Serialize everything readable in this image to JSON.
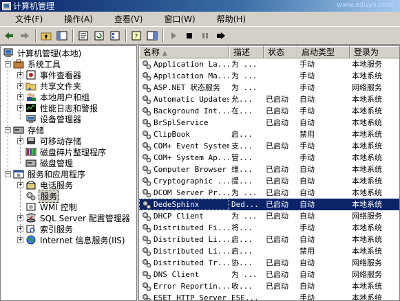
{
  "window": {
    "title": "计算机管理",
    "watermark": "www.eduyo.com"
  },
  "menu": [
    {
      "label": "文件(F)"
    },
    {
      "label": "操作(A)"
    },
    {
      "label": "查看(V)"
    },
    {
      "label": "窗口(W)"
    },
    {
      "label": "帮助(H)"
    }
  ],
  "toolbar": {
    "buttons": [
      "back-icon",
      "forward-icon",
      "up-folder-icon",
      "show-tree-icon",
      "properties-icon",
      "refresh-icon",
      "export-list-icon",
      "help-icon",
      "console-tree-icon",
      "play-icon",
      "stop-icon",
      "pause-icon",
      "restart-icon"
    ]
  },
  "tree": {
    "root": "计算机管理(本地)",
    "system_tools": "系统工具",
    "event_viewer": "事件查看器",
    "shared_folders": "共享文件夹",
    "local_users": "本地用户和组",
    "perf_logs": "性能日志和警报",
    "device_manager": "设备管理器",
    "storage": "存储",
    "removable": "可移动存储",
    "defrag": "磁盘碎片整理程序",
    "disk_mgmt": "磁盘管理",
    "services_apps": "服务和应用程序",
    "telephony": "电话服务",
    "services": "服务",
    "wmi": "WMI 控制",
    "sql": "SQL Server 配置管理器",
    "indexing": "索引服务",
    "iis": "Internet 信息服务(IIS)"
  },
  "columns": {
    "name": "名称",
    "desc": "描述",
    "status": "状态",
    "startup": "启动类型",
    "logon": "登录为"
  },
  "services": [
    {
      "name": "Application La...",
      "desc": "为 ...",
      "status": "",
      "startup": "手动",
      "logon": "本地服务"
    },
    {
      "name": "Application Ma...",
      "desc": "为 ...",
      "status": "",
      "startup": "手动",
      "logon": "本地系统"
    },
    {
      "name": "ASP.NET 状态服务",
      "desc": "为 ...",
      "status": "",
      "startup": "手动",
      "logon": "网络服务"
    },
    {
      "name": "Automatic Updates",
      "desc": "允...",
      "status": "已启动",
      "startup": "自动",
      "logon": "本地系统"
    },
    {
      "name": "Background Int...",
      "desc": "在...",
      "status": "已启动",
      "startup": "手动",
      "logon": "本地系统"
    },
    {
      "name": "BrSplService",
      "desc": "",
      "status": "已启动",
      "startup": "自动",
      "logon": "本地系统"
    },
    {
      "name": "ClipBook",
      "desc": "启...",
      "status": "",
      "startup": "禁用",
      "logon": "本地系统"
    },
    {
      "name": "COM+ Event System",
      "desc": "支...",
      "status": "已启动",
      "startup": "手动",
      "logon": "本地系统"
    },
    {
      "name": "COM+ System Ap...",
      "desc": "管...",
      "status": "",
      "startup": "手动",
      "logon": "本地系统"
    },
    {
      "name": "Computer Browser",
      "desc": "维...",
      "status": "已启动",
      "startup": "自动",
      "logon": "本地系统"
    },
    {
      "name": "Cryptographic ...",
      "desc": "提...",
      "status": "已启动",
      "startup": "自动",
      "logon": "本地系统"
    },
    {
      "name": "DCOM Server Pr...",
      "desc": "为 ...",
      "status": "已启动",
      "startup": "自动",
      "logon": "本地系统"
    },
    {
      "name": "DedeSphinx",
      "desc": "Ded...",
      "status": "已启动",
      "startup": "自动",
      "logon": "本地系统",
      "selected": true
    },
    {
      "name": "DHCP Client",
      "desc": "为 ...",
      "status": "已启动",
      "startup": "自动",
      "logon": "网络服务"
    },
    {
      "name": "Distributed Fi...",
      "desc": "将...",
      "status": "",
      "startup": "手动",
      "logon": "本地系统"
    },
    {
      "name": "Distributed Li...",
      "desc": "启...",
      "status": "已启动",
      "startup": "自动",
      "logon": "本地系统"
    },
    {
      "name": "Distributed Li...",
      "desc": "启...",
      "status": "",
      "startup": "禁用",
      "logon": "本地系统"
    },
    {
      "name": "Distributed Tr...",
      "desc": "协...",
      "status": "已启动",
      "startup": "自动",
      "logon": "网络服务"
    },
    {
      "name": "DNS Client",
      "desc": "为 ...",
      "status": "已启动",
      "startup": "自动",
      "logon": "网络服务"
    },
    {
      "name": "Error Reportin...",
      "desc": "收...",
      "status": "已启动",
      "startup": "自动",
      "logon": "本地系统"
    },
    {
      "name": "ESET HTTP Server",
      "desc": "ESE...",
      "status": "",
      "startup": "手动",
      "logon": "本地系统"
    }
  ]
}
